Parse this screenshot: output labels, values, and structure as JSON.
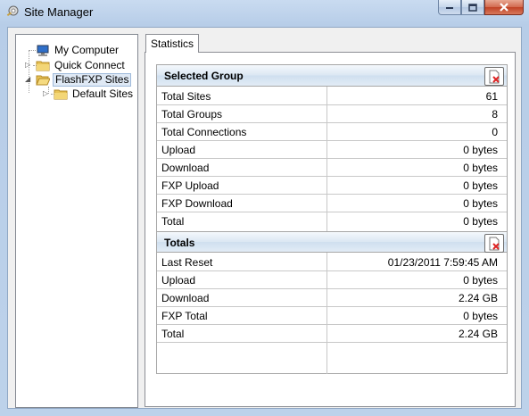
{
  "window": {
    "title": "Site Manager"
  },
  "tree": {
    "items": [
      {
        "label": "My Computer"
      },
      {
        "label": "Quick Connect"
      },
      {
        "label": "FlashFXP Sites"
      },
      {
        "label": "Default Sites"
      }
    ]
  },
  "tabs": [
    {
      "label": "Statistics"
    }
  ],
  "selected_group": {
    "title": "Selected Group",
    "rows": [
      {
        "key": "Total Sites",
        "value": "61"
      },
      {
        "key": "Total Groups",
        "value": "8"
      },
      {
        "key": "Total Connections",
        "value": "0"
      },
      {
        "key": "Upload",
        "value": "0 bytes"
      },
      {
        "key": "Download",
        "value": "0 bytes"
      },
      {
        "key": "FXP Upload",
        "value": "0 bytes"
      },
      {
        "key": "FXP Download",
        "value": "0 bytes"
      },
      {
        "key": "Total",
        "value": "0 bytes"
      }
    ]
  },
  "totals": {
    "title": "Totals",
    "rows": [
      {
        "key": "Last Reset",
        "value": "01/23/2011 7:59:45 AM"
      },
      {
        "key": "Upload",
        "value": "0 bytes"
      },
      {
        "key": "Download",
        "value": "2.24 GB"
      },
      {
        "key": "FXP Total",
        "value": "0 bytes"
      },
      {
        "key": "Total",
        "value": "2.24 GB"
      }
    ]
  },
  "colors": {
    "selection": "#dfe9f5",
    "header": "#dbe7f3",
    "close": "#c04225"
  }
}
